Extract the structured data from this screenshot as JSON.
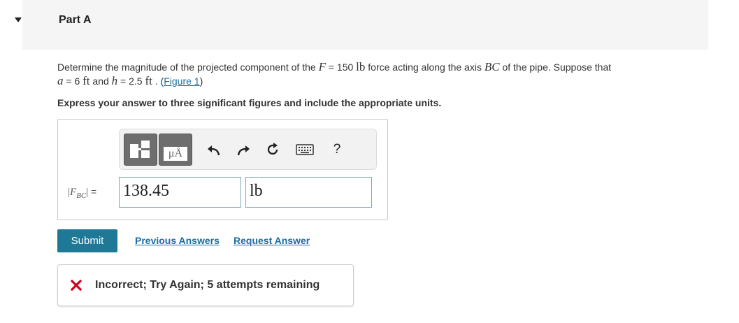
{
  "part": {
    "title": "Part A"
  },
  "problem": {
    "text_1": "Determine the magnitude of the projected component of the ",
    "F_symbol": "F",
    "eq_1": " = 150 ",
    "unit_lb": "lb",
    "text_2": " force acting along the axis ",
    "axis": "BC",
    "text_3": " of the pipe. Suppose that",
    "a_symbol": "a",
    "eq_a": " = 6 ",
    "unit_ft_1": "ft",
    "text_and": " and ",
    "h_symbol": "h",
    "eq_h": " = 2.5 ",
    "unit_ft_2": "ft",
    "text_dot": " . (",
    "figure_link": "Figure 1",
    "text_close": ")"
  },
  "instruction": "Express your answer to three significant figures and include the appropriate units.",
  "answer": {
    "label_main": "F",
    "label_sub": "BC",
    "label_eq": "=",
    "value": "138.45",
    "unit": "lb"
  },
  "toolbar": {
    "symbols_label": "μÅ",
    "help_label": "?"
  },
  "actions": {
    "submit_label": "Submit",
    "previous_answers_label": "Previous Answers",
    "request_answer_label": "Request Answer"
  },
  "feedback": {
    "message": "Incorrect; Try Again; 5 attempts remaining",
    "status_color": "#d0021b"
  },
  "colors": {
    "accent": "#1f7896",
    "link": "#1a6ea0"
  }
}
